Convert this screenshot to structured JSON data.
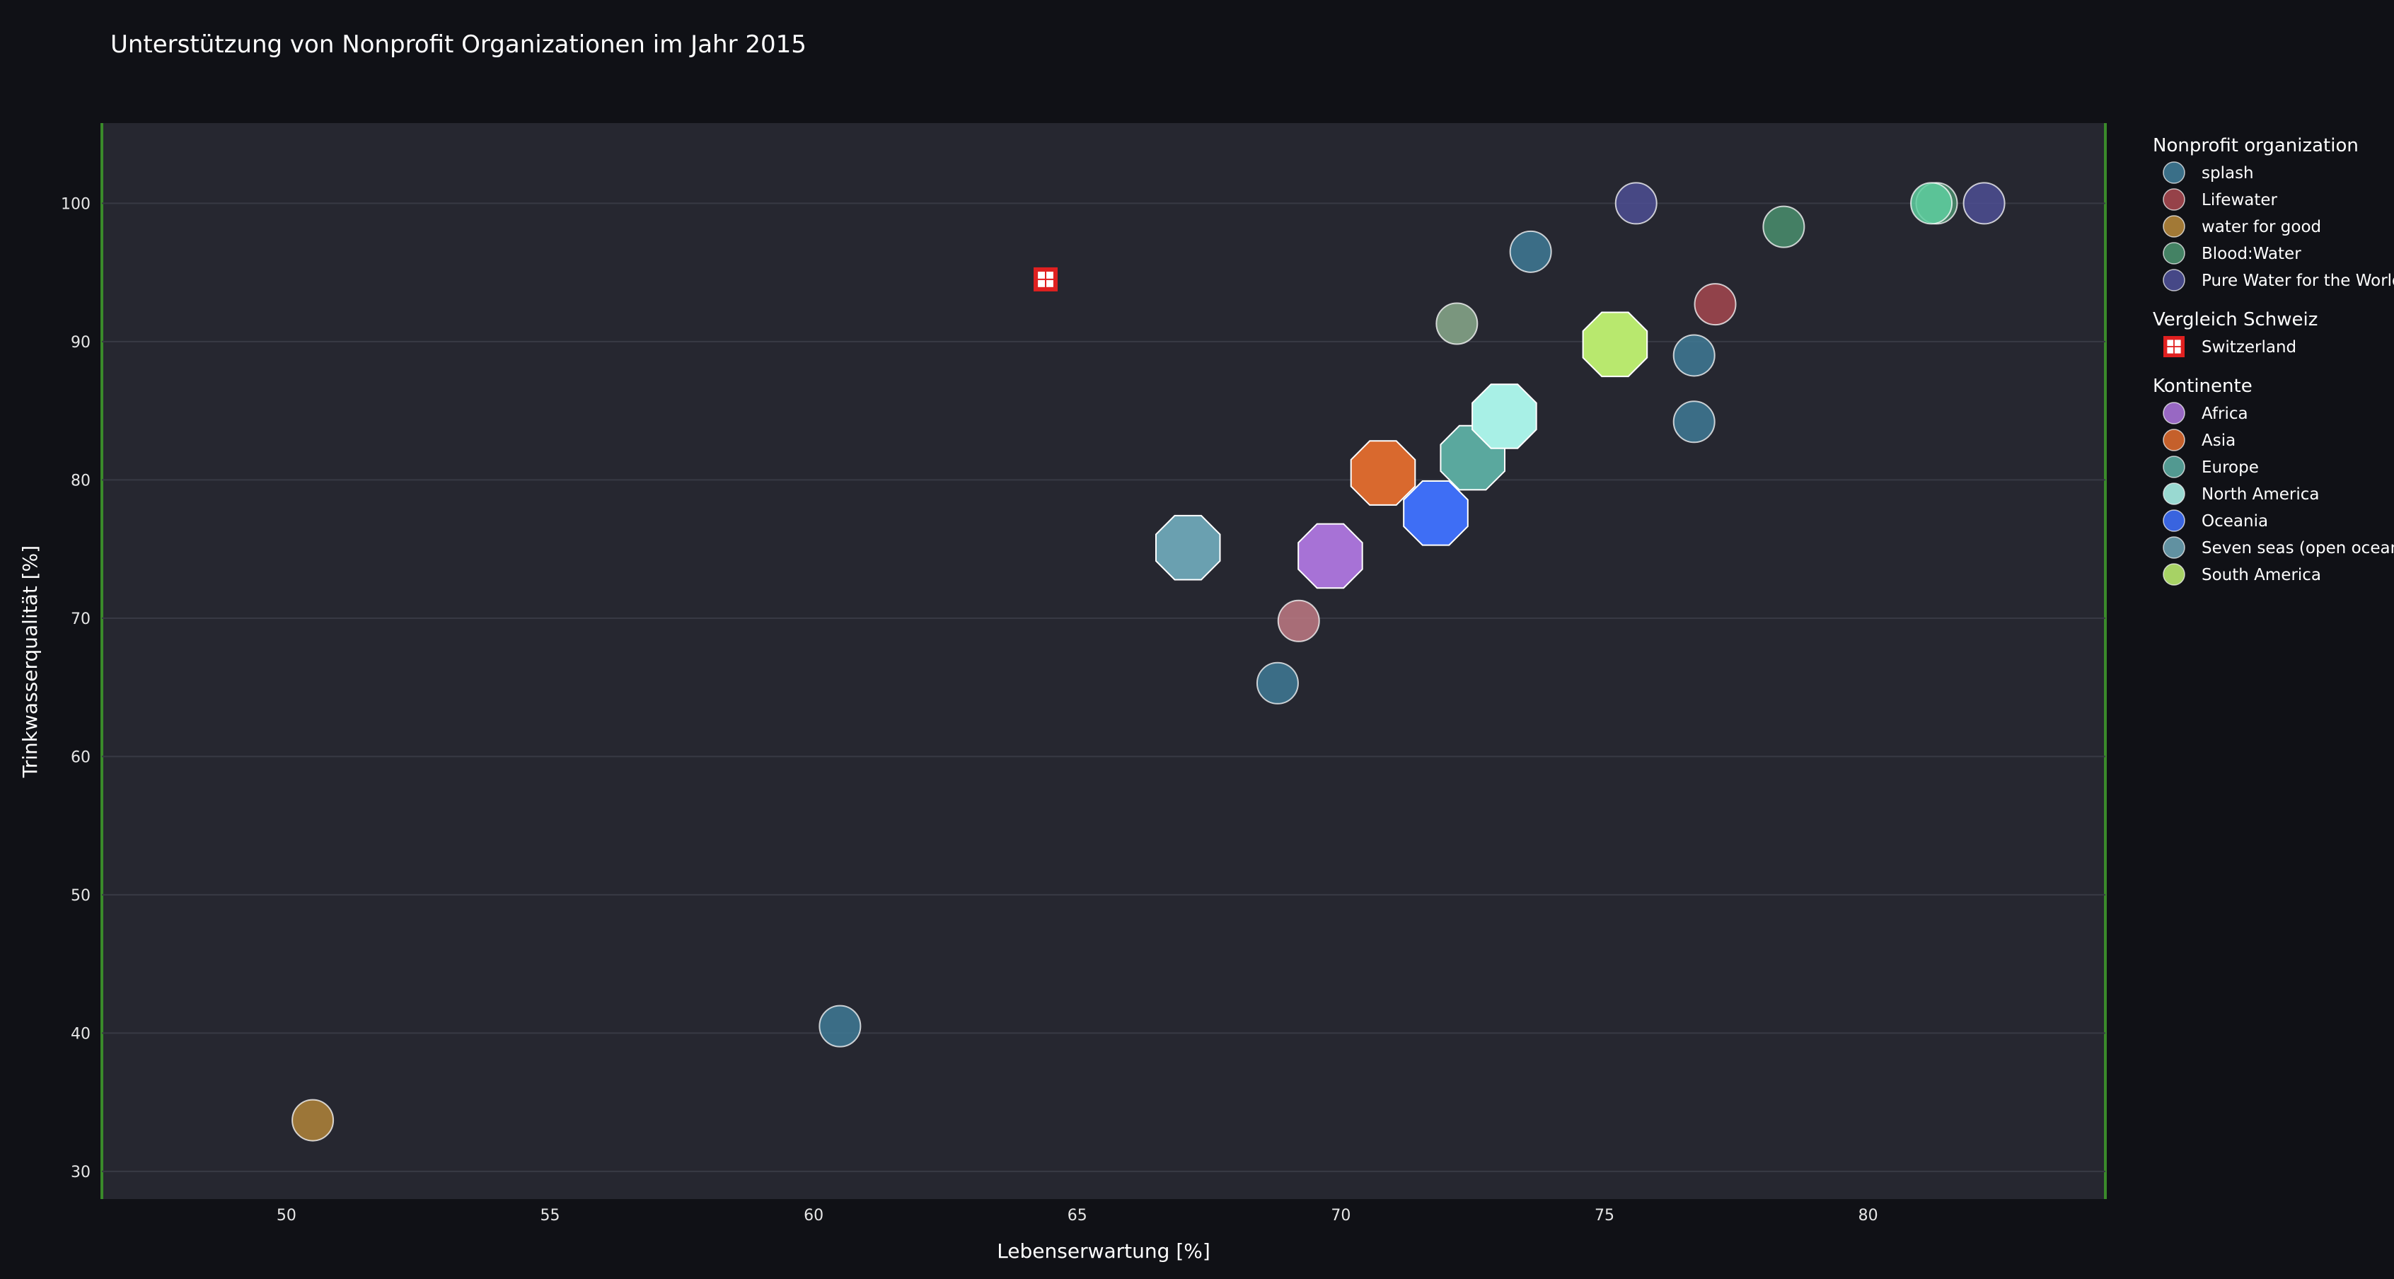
{
  "chart_data": {
    "type": "scatter",
    "title": "Unterstützung von Nonprofit Organizationen im Jahr 2015",
    "xlabel": "Lebenserwartung [%]",
    "ylabel": "Trinkwasserqualität [%]",
    "xlim": [
      46.5,
      84.5
    ],
    "ylim": [
      28,
      105.8
    ],
    "xticks": [
      50,
      55,
      60,
      65,
      70,
      75,
      80
    ],
    "yticks": [
      30,
      40,
      50,
      60,
      70,
      80,
      90,
      100
    ],
    "grid": "horizontal",
    "legend_position": "right",
    "plot_bg": "#262730",
    "page_bg": "#101116",
    "accent_line": "#3a8a2a",
    "legend_groups": [
      {
        "title": "Nonprofit organization",
        "items": [
          {
            "label": "splash",
            "color": "#3f7a95",
            "symbol": "circle"
          },
          {
            "label": "Lifewater",
            "color": "#a5484f",
            "symbol": "circle"
          },
          {
            "label": "water for good",
            "color": "#b2853a",
            "symbol": "circle"
          },
          {
            "label": "Blood:Water",
            "color": "#4a8f6d",
            "symbol": "circle"
          },
          {
            "label": "Pure Water for the World",
            "color": "#4d4f93",
            "symbol": "circle"
          }
        ]
      },
      {
        "title": "Vergleich Schweiz",
        "items": [
          {
            "label": "Switzerland",
            "color": "#e02020",
            "symbol": "cross-square"
          }
        ]
      },
      {
        "title": "Kontinente",
        "items": [
          {
            "label": "Africa",
            "color": "#a772d6",
            "symbol": "octagon"
          },
          {
            "label": "Asia",
            "color": "#d9692e",
            "symbol": "octagon"
          },
          {
            "label": "Europe",
            "color": "#5aa89e",
            "symbol": "octagon"
          },
          {
            "label": "North America",
            "color": "#a8f0e6",
            "symbol": "octagon"
          },
          {
            "label": "Oceania",
            "color": "#3e6ef5",
            "symbol": "octagon"
          },
          {
            "label": "Seven seas (open ocean)",
            "color": "#6aa0b0",
            "symbol": "octagon"
          },
          {
            "label": "South America",
            "color": "#b8e86e",
            "symbol": "octagon"
          }
        ]
      }
    ],
    "series": [
      {
        "name": "splash",
        "symbol": "circle",
        "color": "#3f7a95",
        "points": [
          [
            73.6,
            96.5
          ],
          [
            76.7,
            89
          ],
          [
            76.7,
            84.2
          ],
          [
            68.8,
            65.3
          ],
          [
            60.5,
            40.5
          ]
        ]
      },
      {
        "name": "Lifewater",
        "symbol": "circle",
        "color": "#a5484f",
        "points": [
          [
            77.1,
            92.7
          ]
        ]
      },
      {
        "name": "water for good",
        "symbol": "circle",
        "color": "#b2853a",
        "points": [
          [
            50.5,
            33.7
          ]
        ]
      },
      {
        "name": "Blood:Water",
        "symbol": "circle",
        "color": "#4a8f6d",
        "points": [
          [
            78.4,
            98.3
          ],
          [
            81.3,
            100
          ]
        ]
      },
      {
        "name": "Pure Water for the World",
        "symbol": "circle",
        "color": "#4d4f93",
        "points": [
          [
            75.6,
            100
          ],
          [
            82.2,
            100
          ]
        ]
      },
      {
        "name": "",
        "symbol": "circle",
        "points": [
          {
            "x": 72.2,
            "y": 91.3,
            "color": "#8aaa8c"
          },
          {
            "x": 69.2,
            "y": 69.8,
            "color": "#c07a84"
          },
          {
            "x": 81.2,
            "y": 100,
            "color": "#5fcfa0"
          }
        ]
      },
      {
        "name": "Switzerland",
        "symbol": "cross-square",
        "color": "#e02020",
        "points": [
          [
            64.4,
            94.5
          ]
        ]
      },
      {
        "name": "Africa",
        "symbol": "octagon",
        "color": "#a772d6",
        "points": [
          [
            69.8,
            74.5
          ]
        ]
      },
      {
        "name": "Asia",
        "symbol": "octagon",
        "color": "#d9692e",
        "points": [
          [
            70.8,
            80.5
          ]
        ]
      },
      {
        "name": "Europe",
        "symbol": "octagon",
        "color": "#5aa89e",
        "points": [
          [
            72.5,
            81.6
          ]
        ]
      },
      {
        "name": "North America",
        "symbol": "octagon",
        "color": "#a8f0e6",
        "points": [
          [
            73.1,
            84.6
          ]
        ]
      },
      {
        "name": "Oceania",
        "symbol": "octagon",
        "color": "#3e6ef5",
        "points": [
          [
            71.8,
            77.6
          ]
        ]
      },
      {
        "name": "Seven seas (open ocean)",
        "symbol": "octagon",
        "color": "#6aa0b0",
        "points": [
          [
            67.1,
            75.1
          ]
        ]
      },
      {
        "name": "South America",
        "symbol": "octagon",
        "color": "#b8e86e",
        "points": [
          [
            75.2,
            89.8
          ]
        ]
      }
    ]
  }
}
